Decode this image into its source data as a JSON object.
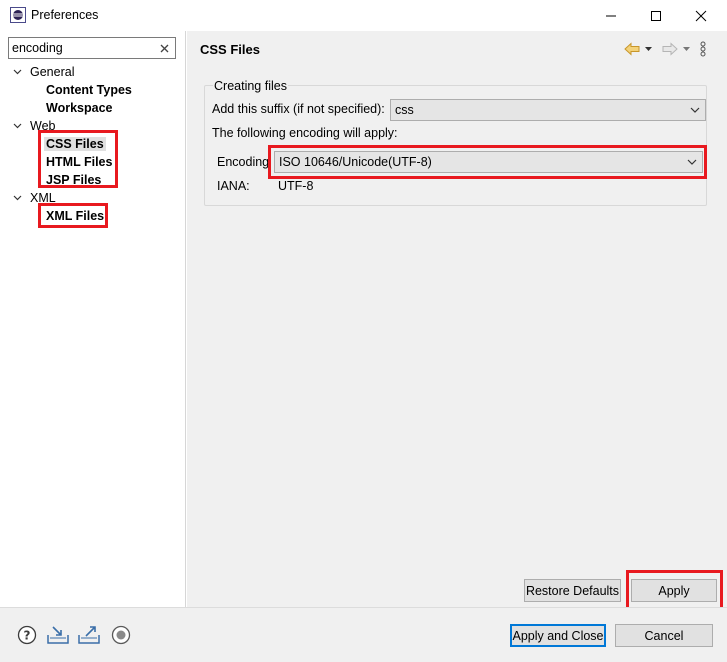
{
  "window": {
    "title": "Preferences"
  },
  "filter": {
    "value": "encoding"
  },
  "tree": {
    "general": "General",
    "content_types": "Content Types",
    "workspace": "Workspace",
    "web": "Web",
    "css_files": "CSS Files",
    "html_files": "HTML Files",
    "jsp_files": "JSP Files",
    "xml": "XML",
    "xml_files": "XML Files"
  },
  "page": {
    "title": "CSS Files",
    "group_label": "Creating files",
    "suffix_label": "Add this suffix (if not specified):",
    "suffix_value": "css",
    "encoding_note": "The following encoding will apply:",
    "encoding_label": "Encoding",
    "encoding_value": "ISO 10646/Unicode(UTF-8)",
    "iana_label": "IANA:",
    "iana_value": "UTF-8"
  },
  "buttons": {
    "restore_defaults": "Restore Defaults",
    "apply": "Apply",
    "apply_and_close": "Apply and Close",
    "cancel": "Cancel"
  },
  "icons": {
    "app": "eclipse-icon",
    "minimize": "minimize-icon",
    "maximize": "maximize-icon",
    "close": "close-icon",
    "clear_filter": "clear-icon",
    "back": "back-arrow-icon",
    "forward": "forward-arrow-icon",
    "menu": "view-menu-icon",
    "help": "help-icon",
    "import": "import-icon",
    "export": "export-icon",
    "record": "record-icon"
  },
  "colors": {
    "highlight_red": "#e8191f",
    "primary_blue": "#0078d7",
    "back_arrow_yellow": "#e8b84a"
  }
}
